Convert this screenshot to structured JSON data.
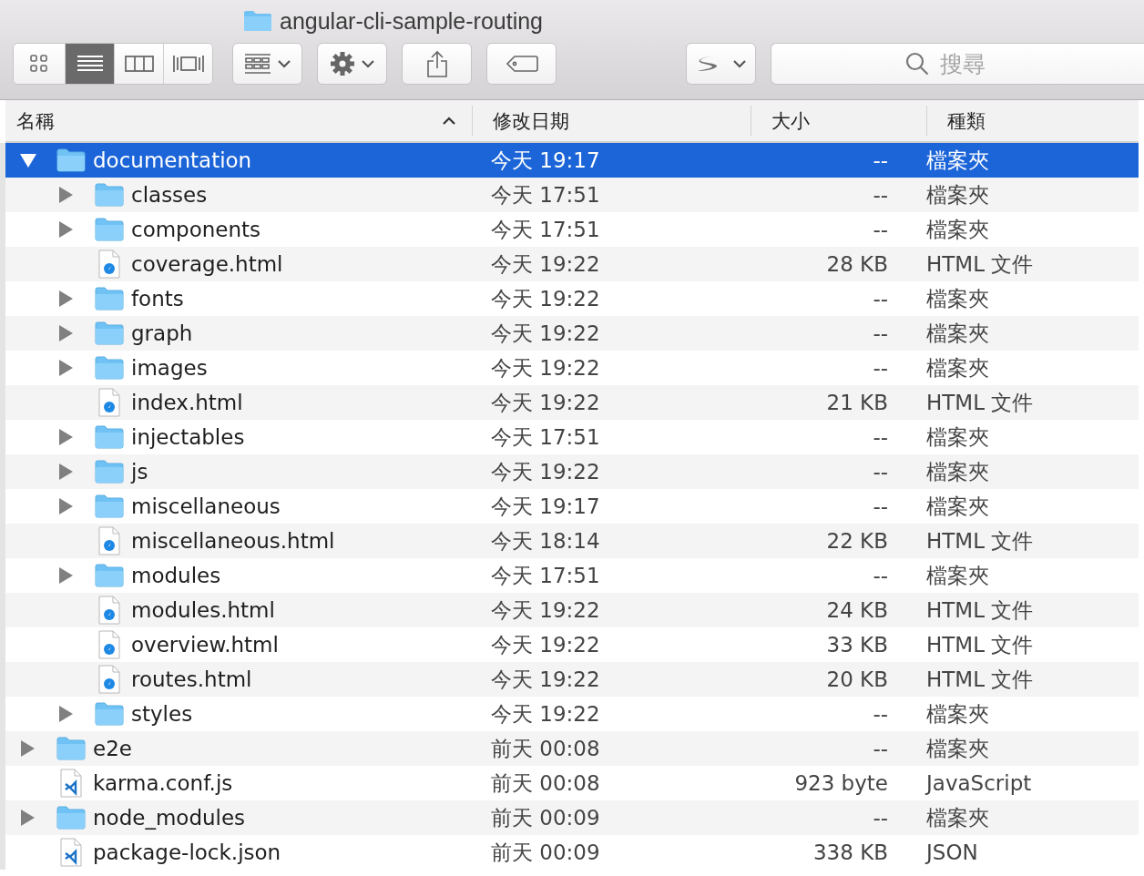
{
  "window": {
    "title": "angular-cli-sample-routing"
  },
  "toolbar": {
    "view_modes": [
      {
        "selected": false
      },
      {
        "selected": true
      },
      {
        "selected": false
      },
      {
        "selected": false
      }
    ],
    "search": {
      "placeholder": "搜尋"
    }
  },
  "columns": [
    {
      "label": "名稱",
      "sorted": true
    },
    {
      "label": "修改日期",
      "sorted": false
    },
    {
      "label": "大小",
      "sorted": false
    },
    {
      "label": "種類",
      "sorted": false
    }
  ],
  "rows": [
    {
      "kind": "folder",
      "name": "documentation",
      "date": "今天 19:17",
      "size": "--",
      "file_kind": "檔案夾",
      "selected": true,
      "expanded": true,
      "children": [
        {
          "kind": "folder",
          "name": "classes",
          "date": "今天 17:51",
          "size": "--",
          "file_kind": "檔案夾",
          "selected": false,
          "expanded": false
        },
        {
          "kind": "folder",
          "name": "components",
          "date": "今天 17:51",
          "size": "--",
          "file_kind": "檔案夾",
          "selected": false,
          "expanded": false
        },
        {
          "kind": "html",
          "name": "coverage.html",
          "date": "今天 19:22",
          "size": "28 KB",
          "file_kind": "HTML 文件",
          "selected": false
        },
        {
          "kind": "folder",
          "name": "fonts",
          "date": "今天 19:22",
          "size": "--",
          "file_kind": "檔案夾",
          "selected": false,
          "expanded": false
        },
        {
          "kind": "folder",
          "name": "graph",
          "date": "今天 19:22",
          "size": "--",
          "file_kind": "檔案夾",
          "selected": false,
          "expanded": false
        },
        {
          "kind": "folder",
          "name": "images",
          "date": "今天 19:22",
          "size": "--",
          "file_kind": "檔案夾",
          "selected": false,
          "expanded": false
        },
        {
          "kind": "html",
          "name": "index.html",
          "date": "今天 19:22",
          "size": "21 KB",
          "file_kind": "HTML 文件",
          "selected": false
        },
        {
          "kind": "folder",
          "name": "injectables",
          "date": "今天 17:51",
          "size": "--",
          "file_kind": "檔案夾",
          "selected": false,
          "expanded": false
        },
        {
          "kind": "folder",
          "name": "js",
          "date": "今天 19:22",
          "size": "--",
          "file_kind": "檔案夾",
          "selected": false,
          "expanded": false
        },
        {
          "kind": "folder",
          "name": "miscellaneous",
          "date": "今天 19:17",
          "size": "--",
          "file_kind": "檔案夾",
          "selected": false,
          "expanded": false
        },
        {
          "kind": "html",
          "name": "miscellaneous.html",
          "date": "今天 18:14",
          "size": "22 KB",
          "file_kind": "HTML 文件",
          "selected": false
        },
        {
          "kind": "folder",
          "name": "modules",
          "date": "今天 17:51",
          "size": "--",
          "file_kind": "檔案夾",
          "selected": false,
          "expanded": false
        },
        {
          "kind": "html",
          "name": "modules.html",
          "date": "今天 19:22",
          "size": "24 KB",
          "file_kind": "HTML 文件",
          "selected": false
        },
        {
          "kind": "html",
          "name": "overview.html",
          "date": "今天 19:22",
          "size": "33 KB",
          "file_kind": "HTML 文件",
          "selected": false
        },
        {
          "kind": "html",
          "name": "routes.html",
          "date": "今天 19:22",
          "size": "20 KB",
          "file_kind": "HTML 文件",
          "selected": false
        },
        {
          "kind": "folder",
          "name": "styles",
          "date": "今天 19:22",
          "size": "--",
          "file_kind": "檔案夾",
          "selected": false,
          "expanded": false
        }
      ]
    },
    {
      "kind": "folder",
      "name": "e2e",
      "date": "前天 00:08",
      "size": "--",
      "file_kind": "檔案夾",
      "selected": false,
      "expanded": false
    },
    {
      "kind": "code",
      "name": "karma.conf.js",
      "date": "前天 00:08",
      "size": "923 byte",
      "file_kind": "JavaScript",
      "selected": false
    },
    {
      "kind": "folder",
      "name": "node_modules",
      "date": "前天 00:09",
      "size": "--",
      "file_kind": "檔案夾",
      "selected": false,
      "expanded": false
    },
    {
      "kind": "code",
      "name": "package-lock.json",
      "date": "前天 00:09",
      "size": "338 KB",
      "file_kind": "JSON",
      "selected": false
    }
  ]
}
